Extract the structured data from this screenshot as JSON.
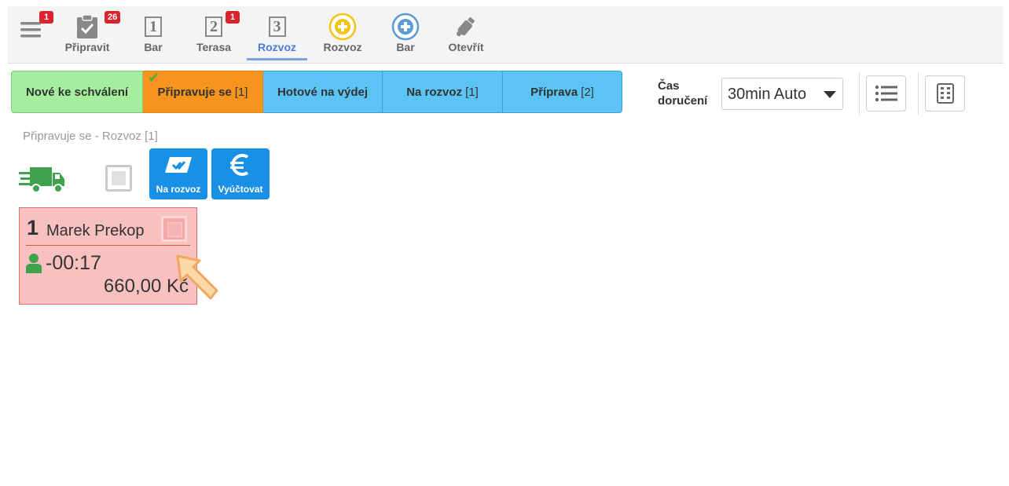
{
  "toolbar": {
    "menu_badge": "1",
    "items": [
      {
        "label": "Připravit",
        "badge": "26"
      },
      {
        "label": "Bar",
        "number": "1"
      },
      {
        "label": "Terasa",
        "number": "2",
        "badge": "1"
      },
      {
        "label": "Rozvoz",
        "number": "3"
      },
      {
        "label": "Rozvoz"
      },
      {
        "label": "Bar"
      },
      {
        "label": "Otevřít"
      }
    ]
  },
  "tabs": [
    {
      "label": "Nové ke schválení",
      "count": ""
    },
    {
      "label": "Připravuje se",
      "count": "[1]"
    },
    {
      "label": "Hotové na výdej",
      "count": ""
    },
    {
      "label": "Na rozvoz",
      "count": "[1]"
    },
    {
      "label": "Příprava",
      "count": "[2]"
    }
  ],
  "delivery": {
    "label_line1": "Čas",
    "label_line2": "doručení",
    "selected": "30min Auto"
  },
  "section": {
    "title": "Připravuje se - Rozvoz [1]",
    "actions": [
      {
        "label": "Na rozvoz"
      },
      {
        "label": "Vyúčtovat"
      }
    ]
  },
  "order": {
    "number": "1",
    "customer": "Marek Prekop",
    "time": "-00:17",
    "price": "660,00 Kč"
  },
  "colors": {
    "accent": "#1890e6",
    "tab_new": "#a5ee9e",
    "tab_active": "#f7941d",
    "tab_default": "#5cc4f5",
    "order_card": "#f9c0c0",
    "badge": "#d9232d"
  }
}
